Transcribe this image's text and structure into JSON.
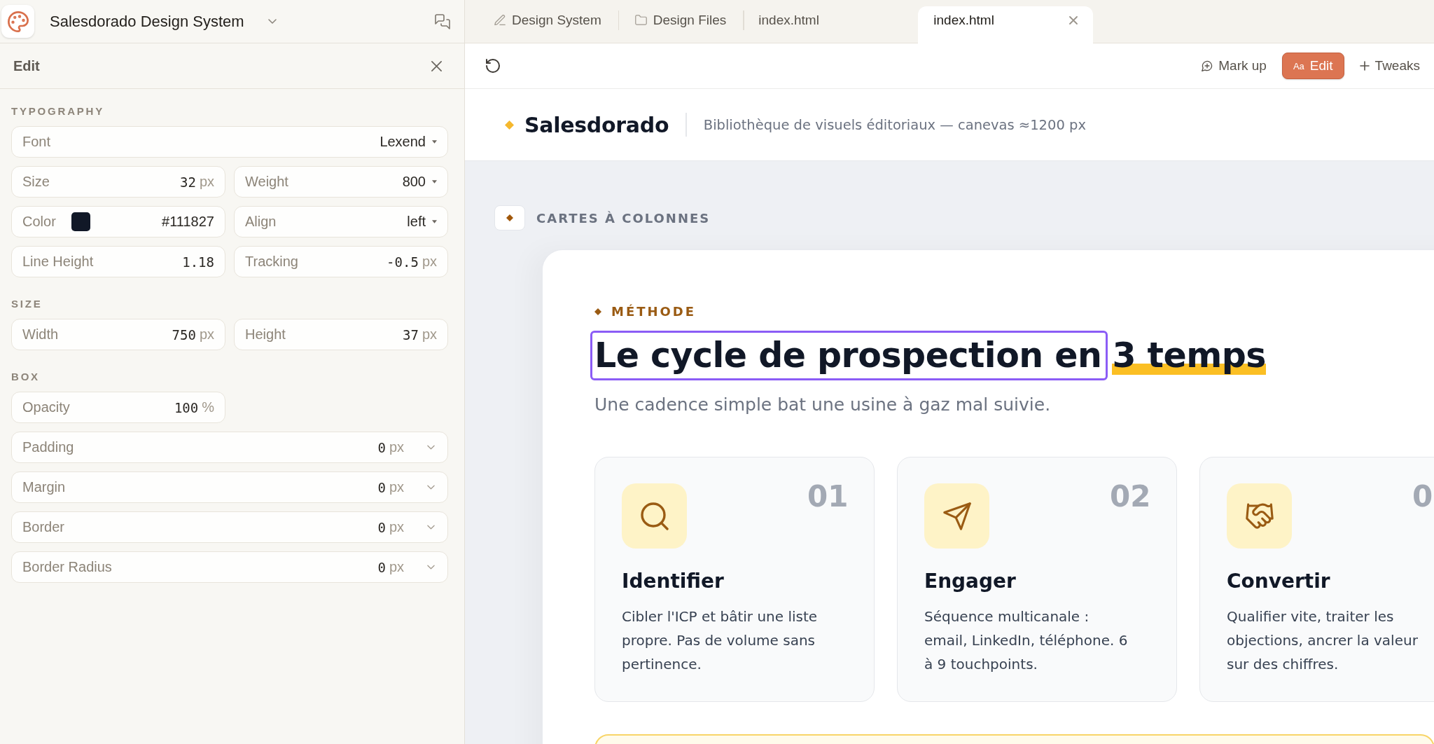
{
  "sidebar": {
    "project_title": "Salesdorado Design System",
    "panel_title": "Edit",
    "sections": [
      {
        "heading": "TYPOGRAPHY",
        "rows": [
          [
            {
              "kind": "select",
              "label": "Font",
              "value": "Lexend"
            }
          ],
          [
            {
              "kind": "number",
              "label": "Size",
              "value": "32",
              "unit": "px"
            },
            {
              "kind": "select",
              "label": "Weight",
              "value": "800"
            }
          ],
          [
            {
              "kind": "color",
              "label": "Color",
              "color": "#111827",
              "value": "#111827"
            },
            {
              "kind": "select",
              "label": "Align",
              "value": "left"
            }
          ],
          [
            {
              "kind": "number",
              "label": "Line Height",
              "value": "1.18"
            },
            {
              "kind": "number",
              "label": "Tracking",
              "value": "-0.5",
              "unit": "px"
            }
          ]
        ]
      },
      {
        "heading": "SIZE",
        "rows": [
          [
            {
              "kind": "number",
              "label": "Width",
              "value": "750",
              "unit": "px"
            },
            {
              "kind": "number",
              "label": "Height",
              "value": "37",
              "unit": "px"
            }
          ]
        ]
      },
      {
        "heading": "BOX",
        "rows": [
          [
            {
              "kind": "number",
              "label": "Opacity",
              "value": "100",
              "unit": "%"
            }
          ],
          [
            {
              "kind": "spacing",
              "label": "Padding",
              "value": "0",
              "unit": "px"
            }
          ],
          [
            {
              "kind": "spacing",
              "label": "Margin",
              "value": "0",
              "unit": "px"
            }
          ],
          [
            {
              "kind": "spacing",
              "label": "Border",
              "value": "0",
              "unit": "px"
            }
          ],
          [
            {
              "kind": "spacing",
              "label": "Border Radius",
              "value": "0",
              "unit": "px"
            }
          ]
        ]
      }
    ]
  },
  "tabs": [
    {
      "kind": "system",
      "label": "Design System",
      "selected": false
    },
    {
      "kind": "folder",
      "label": "Design Files",
      "selected": false
    },
    {
      "kind": "page",
      "label": "index.html",
      "selected": false
    },
    {
      "kind": "page",
      "label": "index.html",
      "selected": true
    }
  ],
  "toolbar": {
    "buttons": [
      {
        "kind": "markup",
        "label": "Mark up",
        "selected": false
      },
      {
        "kind": "edit",
        "icon_text": "Aa",
        "label": "Edit",
        "selected": true
      },
      {
        "kind": "tweaks",
        "label": "Tweaks",
        "selected": false
      }
    ]
  },
  "page": {
    "brand": "Salesdorado",
    "tagline": "Bibliothèque de visuels éditoriaux — canevas ≈1200 px",
    "section_label": "CARTES À COLONNES",
    "eyebrow": "MÉTHODE",
    "heading": [
      {
        "text": "Le cycle de prospection en",
        "selected": true,
        "highlighted": false
      },
      {
        "text": "3 temps",
        "selected": false,
        "highlighted": true
      }
    ],
    "subtitle": "Une cadence simple bat une usine à gaz mal suivie.",
    "steps": [
      {
        "kind": "search",
        "number": "01",
        "title": "Identifier",
        "text": "Cibler l'ICP et bâtir une liste propre. Pas de volume sans pertinence."
      },
      {
        "kind": "send",
        "number": "02",
        "title": "Engager",
        "text": "Séquence multicanale : email, LinkedIn, téléphone. 6 à 9 touchpoints."
      },
      {
        "kind": "handshake",
        "number": "0",
        "title": "Convertir",
        "text": "Qualifier vite, traiter les objections, ancrer la valeur sur des chiffres."
      }
    ]
  }
}
